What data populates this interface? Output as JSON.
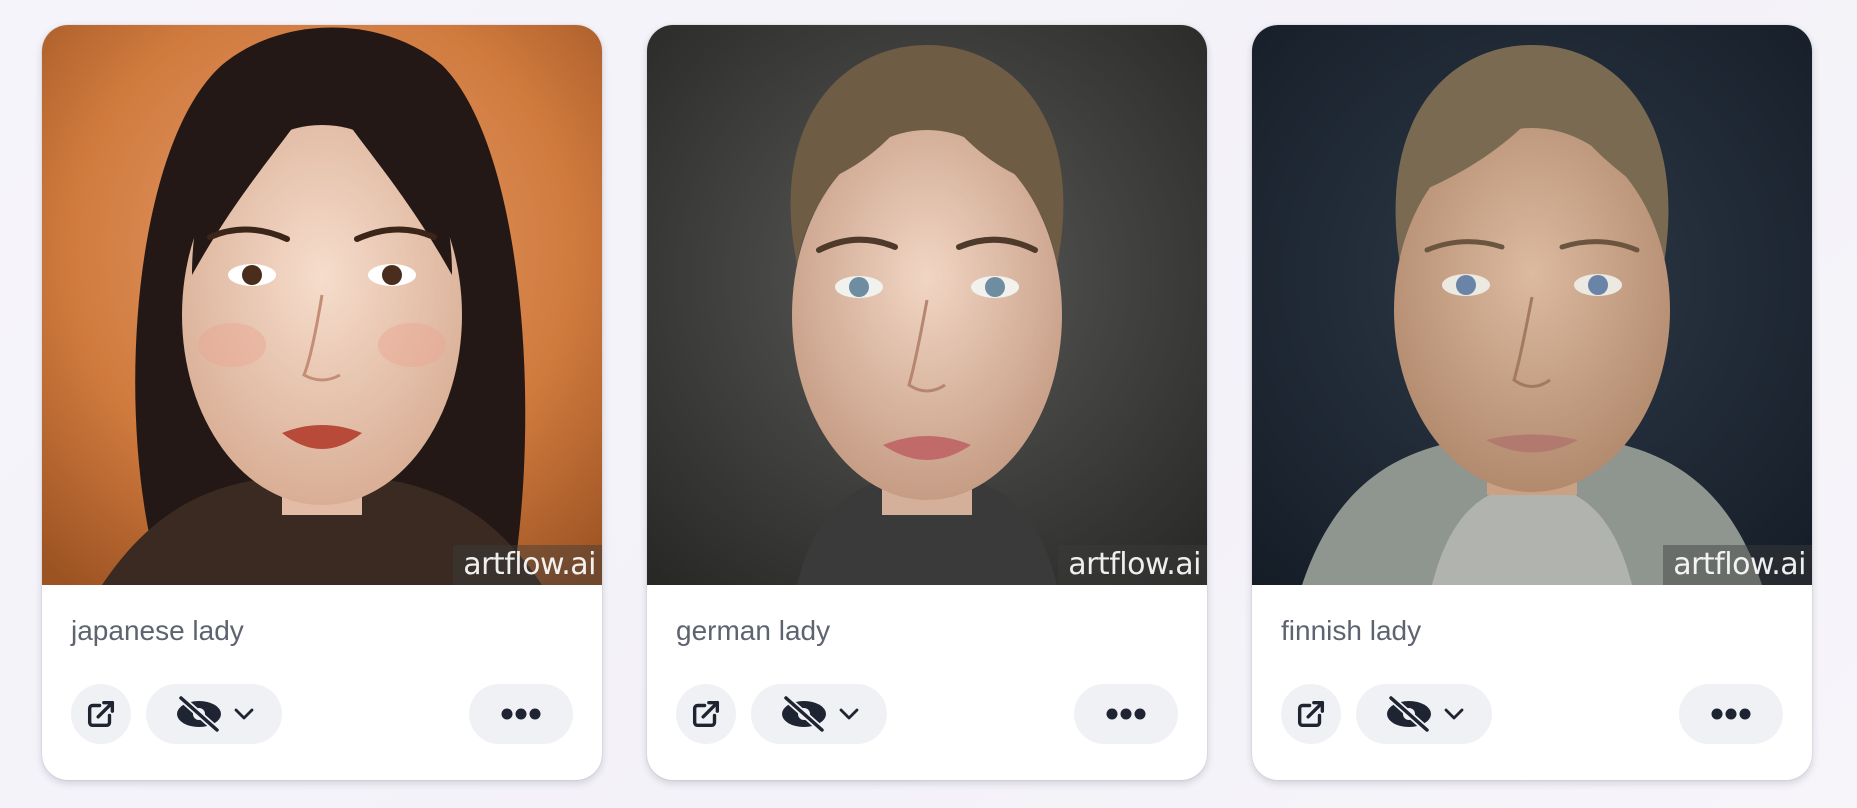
{
  "cards": [
    {
      "title": "japanese lady",
      "watermark": "artflow.ai",
      "actions": {
        "open_icon": "external-link-icon",
        "visibility_icon": "eye-slash-icon",
        "dropdown_icon": "chevron-down-icon",
        "more_icon": "ellipsis-icon"
      }
    },
    {
      "title": "german lady",
      "watermark": "artflow.ai",
      "actions": {
        "open_icon": "external-link-icon",
        "visibility_icon": "eye-slash-icon",
        "dropdown_icon": "chevron-down-icon",
        "more_icon": "ellipsis-icon"
      }
    },
    {
      "title": "finnish lady",
      "watermark": "artflow.ai",
      "actions": {
        "open_icon": "external-link-icon",
        "visibility_icon": "eye-slash-icon",
        "dropdown_icon": "chevron-down-icon",
        "more_icon": "ellipsis-icon"
      }
    }
  ],
  "colors": {
    "card_bg": "#ffffff",
    "button_bg": "#f0f1f4",
    "icon": "#1f2433",
    "title_text": "#5d6470"
  }
}
